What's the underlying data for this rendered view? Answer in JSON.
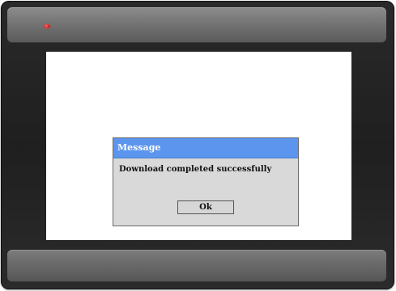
{
  "device": {
    "status_led_color": "#d42a2a",
    "bezel_color": "#222222",
    "strip_color": "#6f6f6f"
  },
  "dialog": {
    "title": "Message",
    "message": "Download completed successfully",
    "ok_label": "Ok",
    "title_bar_color": "#5b95ee",
    "body_color": "#d9d9d9"
  }
}
